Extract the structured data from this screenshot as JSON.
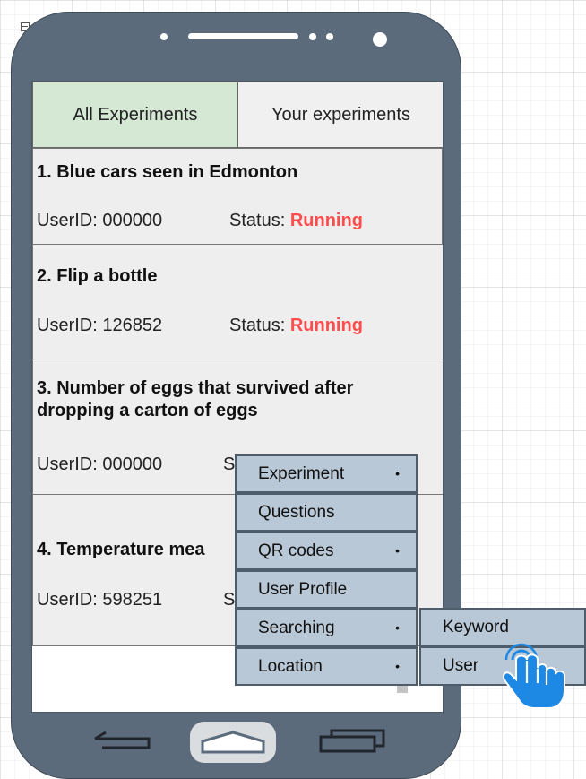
{
  "tabs": [
    {
      "label": "All Experiments"
    },
    {
      "label": "Your experiments"
    }
  ],
  "experiments": [
    {
      "title": "1. Blue cars seen in Edmonton",
      "user": "UserID: 000000",
      "status_label": "Status:",
      "status": "Running"
    },
    {
      "title": "2. Flip a bottle",
      "user": "UserID: 126852",
      "status_label": "Status:",
      "status": "Running"
    },
    {
      "title": "3. Number of eggs that survived after dropping a carton of eggs",
      "user": "UserID: 000000",
      "status_label": "S"
    },
    {
      "title": "4. Temperature mea",
      "user": "UserID: 598251",
      "status_label": "S"
    }
  ],
  "menu": {
    "items": [
      {
        "label": "Experiment",
        "arrow": "•"
      },
      {
        "label": "Questions"
      },
      {
        "label": "QR codes",
        "arrow": "•"
      },
      {
        "label": "User Profile"
      },
      {
        "label": "Searching",
        "arrow": "•"
      },
      {
        "label": "Location",
        "arrow": "•"
      }
    ],
    "submenu": [
      {
        "label": "Keyword"
      },
      {
        "label": "User"
      }
    ]
  },
  "colors": {
    "phone_body": "#5b6b7b",
    "tab_active": "#d5e8d4",
    "status_running": "#ff4d4d",
    "menu_bg": "#b9c8d6",
    "cursor": "#1e88e5"
  },
  "icons": [
    "collapse-icon",
    "back-icon",
    "home-icon",
    "recent-apps-icon",
    "hand-pointer-icon"
  ]
}
